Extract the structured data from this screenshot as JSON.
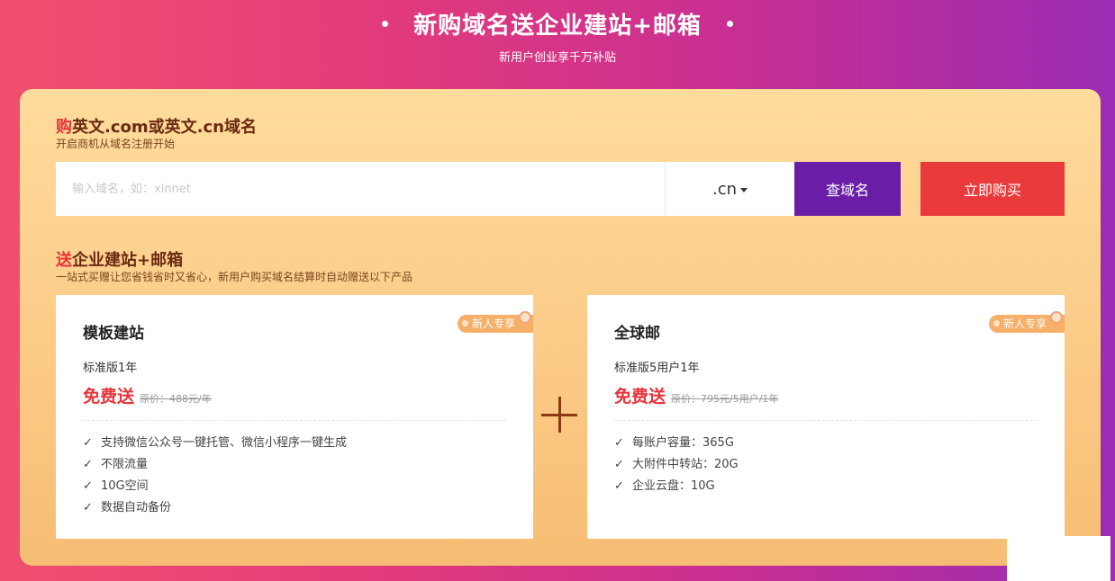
{
  "banner": {
    "title": "新购域名送企业建站+邮箱",
    "subtitle": "新用户创业享千万补贴"
  },
  "buy_section": {
    "title_highlight": "购",
    "title_rest": "英文.com或英文.cn域名",
    "subtitle": "开启商机从域名注册开始"
  },
  "search": {
    "placeholder": "输入域名，如：xinnet",
    "suffix": ".cn",
    "query_label": "查域名",
    "buy_label": "立即购买"
  },
  "gift_section": {
    "title_highlight": "送",
    "title_rest": "企业建站+邮箱",
    "subtitle": "一站式买赠让您省钱省时又省心，新用户购买域名结算时自动赠送以下产品"
  },
  "cards": [
    {
      "title": "模板建站",
      "tag": "新人专享",
      "spec": "标准版1年",
      "free_label": "免费送",
      "original_price": "原价：488元/年",
      "features": [
        "支持微信公众号一键托管、微信小程序一键生成",
        "不限流量",
        "10G空间",
        "数据自动备份"
      ]
    },
    {
      "title": "全球邮",
      "tag": "新人专享",
      "spec": "标准版5用户1年",
      "free_label": "免费送",
      "original_price": "原价：795元/5用户/1年",
      "features": [
        "每账户容量：365G",
        "大附件中转站：20G",
        "企业云盘：10G"
      ]
    }
  ],
  "check_mark": "✓"
}
